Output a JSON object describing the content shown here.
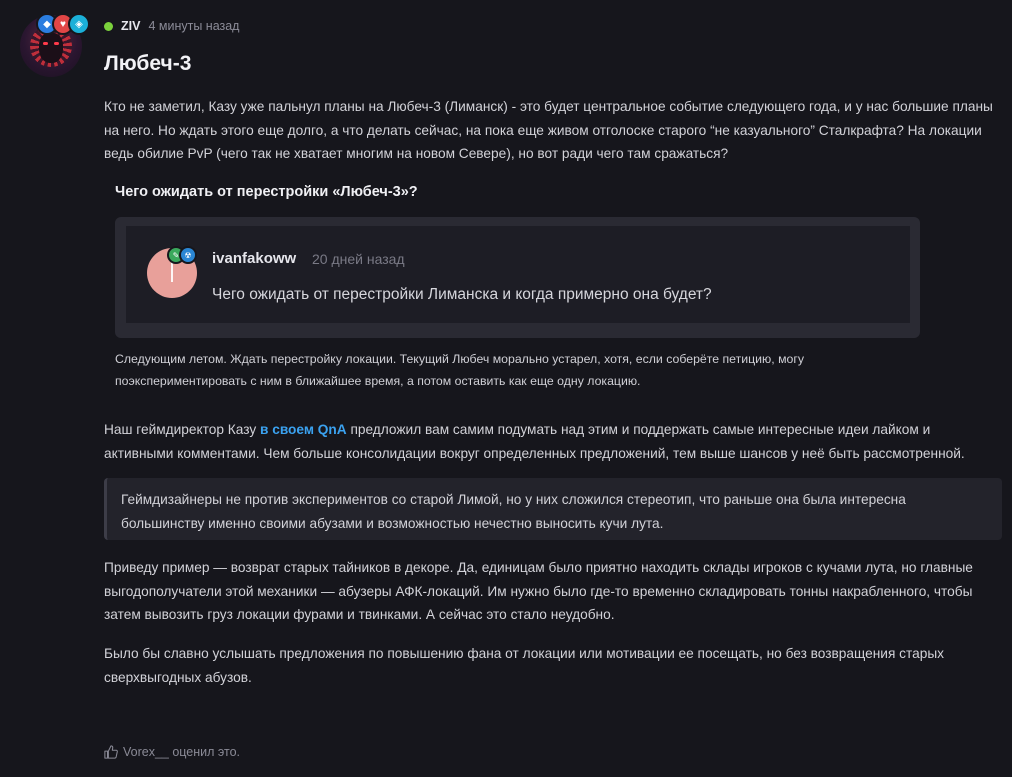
{
  "post": {
    "author": "ZIV",
    "time": "4 минуты назад",
    "title": "Любеч-3",
    "intro": "Кто не заметил, Казу уже пальнул планы на Любеч-3 (Лиманск) - это будет центральное событие следующего года, и у нас большие планы на него. Но ждать этого еще долго, а что делать сейчас, на пока еще живом отголоске старого “не казуального” Сталкрафта? На локации ведь обилие PvP (чего так не хватает многим на новом Севере), но вот ради чего там сражаться?"
  },
  "qna": {
    "heading": "Чего ожидать от перестройки «Любеч-3»?",
    "quoted_author": "ivanfakoww",
    "quoted_time": "20 дней назад",
    "quoted_text": "Чего ожидать от перестройки Лиманска и когда примерно она будет?",
    "answer": "Следующим летом. Ждать перестройку локации. Текущий Любеч морально устарел, хотя, если соберёте петицию, могу поэкспериментировать с ним в ближайшее время, а потом оставить как еще одну локацию."
  },
  "body": {
    "p2_before": "Наш геймдиректор Казу ",
    "p2_link": "в своем QnA",
    "p2_after": " предложил вам самим подумать над этим и поддержать самые интересные идеи лайком и активными комментами. Чем больше консолидации вокруг определенных предложений, тем выше шансов у неё быть рассмотренной.",
    "quote": "Геймдизайнеры не против экспериментов со старой Лимой, но у них сложился стереотип, что раньше она была интересна большинству именно своими абузами и возможностью нечестно выносить кучи лута.",
    "p3": "Приведу пример — возврат старых тайников в декоре. Да, единицам было приятно находить склады игроков с кучами лута, но главные выгодополучатели этой механики — абузеры АФК-локаций. Им нужно было где-то временно складировать тонны накрабленного, чтобы затем вывозить груз локации фурами и твинками. А сейчас это стало неудобно.",
    "p4": "Было бы славно услышать предложения по повышению фана от локации или мотивации ее посещать, но без возвращения старых сверхвыгодных абузов."
  },
  "reactions": {
    "text": "Vorex__ оценил это."
  },
  "colors": {
    "online": "#7bd13c",
    "link": "#3ba2f0",
    "background": "#16161c"
  },
  "icons": [
    "avatar",
    "shield-badge-icon",
    "heart-badge-icon",
    "diamond-badge-icon",
    "online-dot-icon",
    "like-icon"
  ]
}
